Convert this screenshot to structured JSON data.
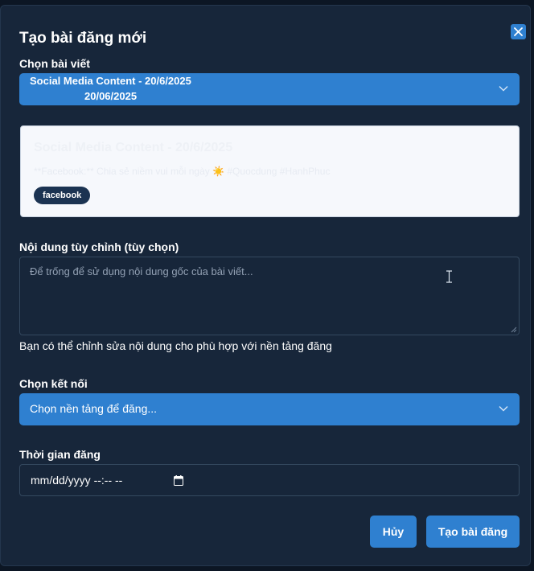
{
  "modal": {
    "title": "Tạo bài đăng mới",
    "close_icon": "close-icon"
  },
  "post_select": {
    "label": "Chọn bài viết",
    "selected_line1": "Social Media Content - 20/6/2025",
    "selected_line2": "20/06/2025"
  },
  "preview": {
    "title": "Social Media Content - 20/6/2025",
    "body": "**Facebook:** Chia sẻ niềm vui mỗi ngày ☀️ #Quocdung #HanhPhuc",
    "tag": "facebook"
  },
  "custom_content": {
    "label": "Nội dung tùy chỉnh (tùy chọn)",
    "placeholder": "Để trống để sử dụng nội dung gốc của bài viết...",
    "helper": "Bạn có thể chỉnh sửa nội dung cho phù hợp với nền tảng đăng"
  },
  "connection": {
    "label": "Chọn kết nối",
    "placeholder": "Chọn nền tảng để đăng..."
  },
  "schedule": {
    "label": "Thời gian đăng",
    "value": "mm/dd/yyyy --:-- --"
  },
  "actions": {
    "cancel": "Hủy",
    "create": "Tạo bài đăng"
  },
  "colors": {
    "background": "#17263a",
    "accent": "#2f80d0",
    "tag_bg": "#1b3352"
  }
}
